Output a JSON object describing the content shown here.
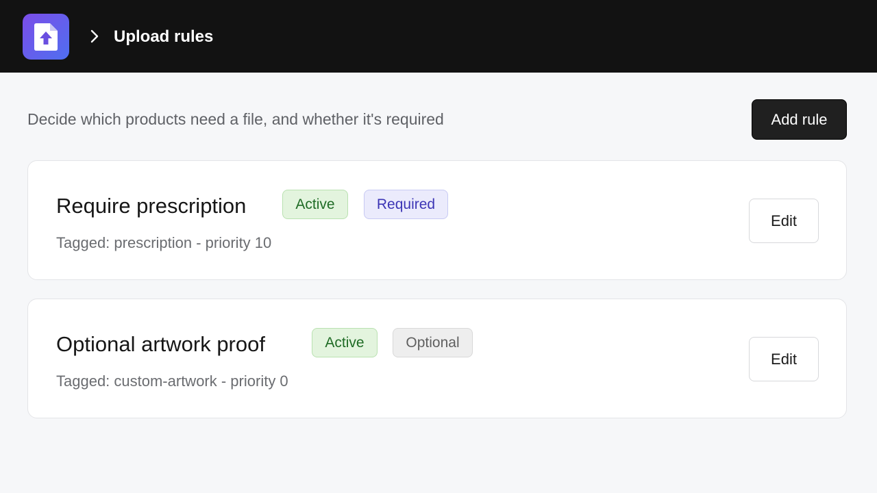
{
  "header": {
    "app_icon": "file-upload-icon",
    "breadcrumb_icon": "chevron-right-icon",
    "title": "Upload rules"
  },
  "main": {
    "subtitle": "Decide which products need a file, and whether it's required",
    "add_rule_label": "Add rule"
  },
  "rules": [
    {
      "name": "Require prescription",
      "status": "Active",
      "requirement": "Required",
      "meta": "Tagged: prescription - priority 10",
      "edit_label": "Edit"
    },
    {
      "name": "Optional artwork proof",
      "status": "Active",
      "requirement": "Optional",
      "meta": "Tagged: custom-artwork - priority 0",
      "edit_label": "Edit"
    }
  ],
  "colors": {
    "topbar": "#121212",
    "icon_gradient_start": "#7b4de8",
    "icon_gradient_end": "#4f6ff0",
    "active_badge": "#1f6b25",
    "required_badge": "#3c35b5",
    "optional_badge": "#5f5f5f"
  }
}
